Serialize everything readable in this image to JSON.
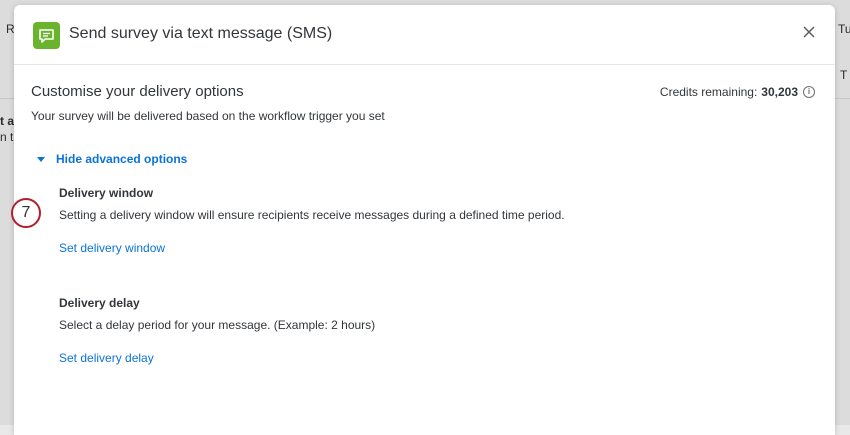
{
  "background": {
    "left_snippets": [
      "R",
      "t a",
      "n t"
    ],
    "right_snippets": [
      "Tu",
      "T"
    ]
  },
  "modal": {
    "title": "Send survey via text message (SMS)",
    "icon": "speech-bubble-icon",
    "icon_color": "#6ab42d",
    "close_icon": "close-icon"
  },
  "delivery": {
    "heading": "Customise your delivery options",
    "credits_label": "Credits remaining:",
    "credits_value": "30,203",
    "subtitle": "Your survey will be delivered based on the workflow trigger you set",
    "toggle_label": "Hide advanced options",
    "window": {
      "title": "Delivery window",
      "description": "Setting a delivery window will ensure recipients receive messages during a defined time period.",
      "link": "Set delivery window"
    },
    "delay": {
      "title": "Delivery delay",
      "description": "Select a delay period for your message. (Example: 2 hours)",
      "link": "Set delivery delay"
    }
  },
  "annotation": {
    "step": "7",
    "color": "#b21f2d"
  },
  "colors": {
    "link": "#0b73d8",
    "text": "#32363a"
  }
}
